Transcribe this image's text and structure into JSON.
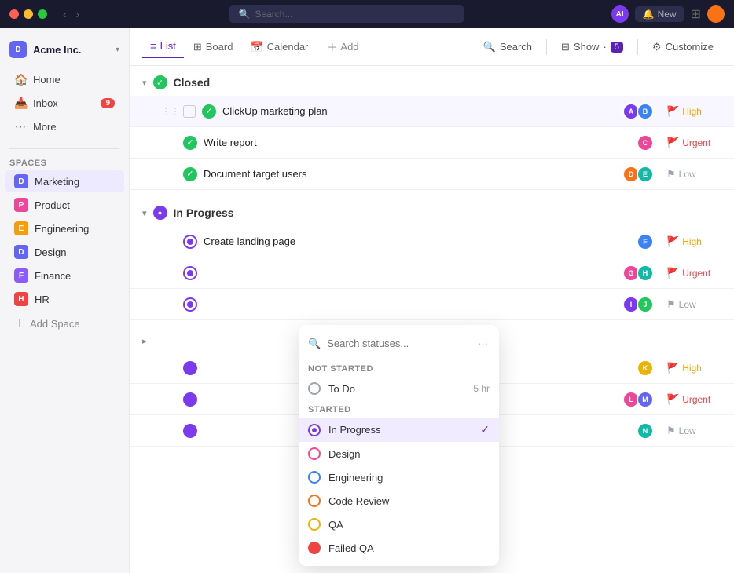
{
  "titlebar": {
    "search_placeholder": "Search...",
    "ai_label": "AI",
    "new_label": "New"
  },
  "sidebar": {
    "workspace_name": "Acme Inc.",
    "nav_items": [
      {
        "id": "home",
        "icon": "🏠",
        "label": "Home"
      },
      {
        "id": "inbox",
        "icon": "📥",
        "label": "Inbox",
        "badge": "9"
      },
      {
        "id": "more",
        "icon": "⋯",
        "label": "More"
      }
    ],
    "spaces_section": "Spaces",
    "spaces": [
      {
        "id": "marketing",
        "icon": "D",
        "color": "#6366f1",
        "label": "Marketing",
        "active": true
      },
      {
        "id": "product",
        "icon": "P",
        "color": "#ec4899",
        "label": "Product"
      },
      {
        "id": "engineering",
        "icon": "E",
        "color": "#f59e0b",
        "label": "Engineering"
      },
      {
        "id": "design",
        "icon": "D",
        "color": "#6366f1",
        "label": "Design"
      },
      {
        "id": "finance",
        "icon": "F",
        "color": "#8b5cf6",
        "label": "Finance"
      },
      {
        "id": "hr",
        "icon": "H",
        "color": "#ef4444",
        "label": "HR"
      }
    ],
    "add_space_label": "Add Space"
  },
  "topbar": {
    "tabs": [
      {
        "id": "list",
        "icon": "≡",
        "label": "List",
        "active": true
      },
      {
        "id": "board",
        "icon": "⊞",
        "label": "Board"
      },
      {
        "id": "calendar",
        "icon": "📅",
        "label": "Calendar"
      }
    ],
    "add_label": "Add",
    "search_label": "Search",
    "show_label": "Show",
    "show_count": "5",
    "customize_label": "Customize"
  },
  "sections": {
    "closed": {
      "label": "Closed",
      "tasks": [
        {
          "id": "t1",
          "title": "ClickUp marketing plan",
          "priority": "High",
          "priority_type": "high",
          "avatars": [
            "av-purple",
            "av-blue"
          ]
        },
        {
          "id": "t2",
          "title": "Write report",
          "priority": "Urgent",
          "priority_type": "urgent",
          "avatars": [
            "av-pink"
          ]
        },
        {
          "id": "t3",
          "title": "Document target users",
          "priority": "Low",
          "priority_type": "low",
          "avatars": [
            "av-orange",
            "av-teal"
          ]
        }
      ]
    },
    "inprogress": {
      "label": "In Progress",
      "tasks": [
        {
          "id": "t4",
          "title": "Create landing page",
          "priority": "High",
          "priority_type": "high",
          "avatars": [
            "av-blue"
          ]
        },
        {
          "id": "t5",
          "title": "...",
          "priority": "Urgent",
          "priority_type": "urgent",
          "avatars": [
            "av-pink",
            "av-teal"
          ]
        },
        {
          "id": "t6",
          "title": "...",
          "priority": "Low",
          "priority_type": "low",
          "avatars": [
            "av-purple",
            "av-green"
          ]
        }
      ]
    },
    "second_inprogress": {
      "tasks": [
        {
          "id": "t7",
          "priority": "High",
          "priority_type": "high",
          "avatars": [
            "av-yellow"
          ]
        },
        {
          "id": "t8",
          "priority": "Urgent",
          "priority_type": "urgent",
          "avatars": [
            "av-pink",
            "av-indigo"
          ]
        },
        {
          "id": "t9",
          "priority": "Low",
          "priority_type": "low",
          "avatars": [
            "av-teal"
          ]
        }
      ]
    }
  },
  "dropdown": {
    "search_placeholder": "Search statuses...",
    "sections": {
      "not_started": "NOT STARTED",
      "started": "STARTED"
    },
    "statuses": [
      {
        "id": "todo",
        "label": "To Do",
        "time": "5 hr",
        "type": "todo",
        "section": "not_started"
      },
      {
        "id": "inprogress",
        "label": "In Progress",
        "type": "inprogress",
        "active": true,
        "section": "started"
      },
      {
        "id": "design",
        "label": "Design",
        "type": "design",
        "section": "started"
      },
      {
        "id": "engineering",
        "label": "Engineering",
        "type": "engineering",
        "section": "started"
      },
      {
        "id": "codereview",
        "label": "Code Review",
        "type": "codereview",
        "section": "started"
      },
      {
        "id": "qa",
        "label": "QA",
        "type": "qa",
        "section": "started"
      },
      {
        "id": "failedqa",
        "label": "Failed QA",
        "type": "failedqa",
        "section": "started"
      }
    ]
  }
}
